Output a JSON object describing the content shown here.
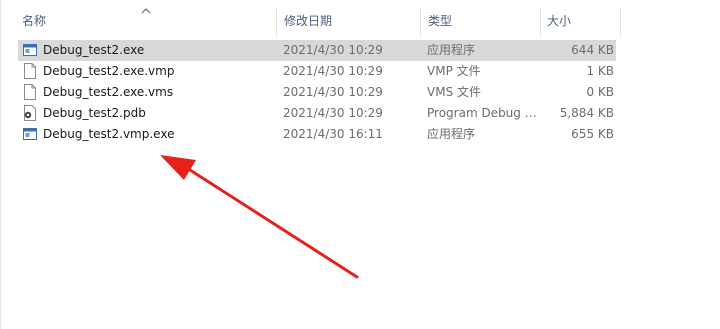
{
  "columns": {
    "name": "名称",
    "modified": "修改日期",
    "type": "类型",
    "size": "大小"
  },
  "files": [
    {
      "name": "Debug_test2.exe",
      "modified": "2021/4/30 10:29",
      "type": "应用程序",
      "size": "644 KB",
      "icon": "exe-icon",
      "selected": true
    },
    {
      "name": "Debug_test2.exe.vmp",
      "modified": "2021/4/30 10:29",
      "type": "VMP 文件",
      "size": "1 KB",
      "icon": "document-icon",
      "selected": false
    },
    {
      "name": "Debug_test2.exe.vms",
      "modified": "2021/4/30 10:29",
      "type": "VMS 文件",
      "size": "0 KB",
      "icon": "document-icon",
      "selected": false
    },
    {
      "name": "Debug_test2.pdb",
      "modified": "2021/4/30 10:29",
      "type": "Program Debug Database",
      "size": "5,884 KB",
      "icon": "pdb-icon",
      "selected": false
    },
    {
      "name": "Debug_test2.vmp.exe",
      "modified": "2021/4/30 16:11",
      "type": "应用程序",
      "size": "655 KB",
      "icon": "exe-icon",
      "selected": false
    }
  ],
  "colors": {
    "selected_row": "#d9d9d9",
    "header_text": "#4c607a",
    "arrow": "#e8201c"
  }
}
